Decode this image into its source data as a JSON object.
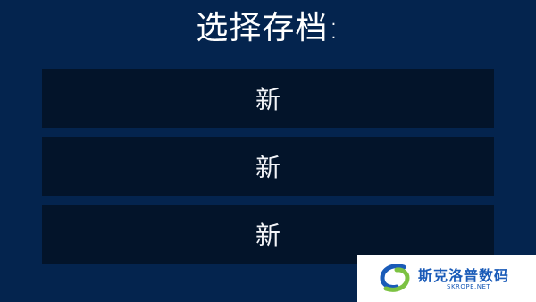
{
  "screen": {
    "title": "选择存档:"
  },
  "save_slots": [
    {
      "label": "新"
    },
    {
      "label": "新"
    },
    {
      "label": "新"
    }
  ],
  "watermark": {
    "name": "斯克洛普数码",
    "url": "SKROPE.NET"
  },
  "colors": {
    "background": "#04244e",
    "slot_background": "#03142a",
    "text": "#ffffff",
    "watermark_blue": "#1a5bb8",
    "watermark_green": "#7cc242"
  }
}
